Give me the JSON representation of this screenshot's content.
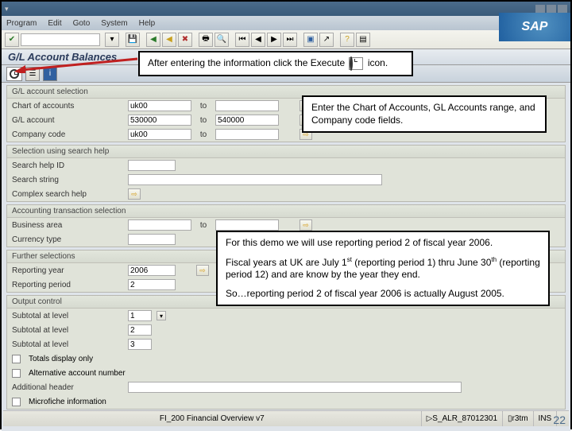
{
  "menu": {
    "items": [
      "Program",
      "Edit",
      "Goto",
      "System",
      "Help"
    ]
  },
  "logo": "SAP",
  "screen_title": "G/L Account Balances",
  "sections": {
    "acct": {
      "title": "G/L account selection",
      "rows": [
        {
          "label": "Chart of accounts",
          "from": "uk00",
          "to": ""
        },
        {
          "label": "G/L account",
          "from": "530000",
          "to": "540000"
        },
        {
          "label": "Company code",
          "from": "uk00",
          "to": ""
        }
      ]
    },
    "search": {
      "title": "Selection using search help",
      "rows": [
        {
          "label": "Search help ID"
        },
        {
          "label": "Search string"
        },
        {
          "label": "Complex search help"
        }
      ]
    },
    "trans": {
      "title": "Accounting transaction selection",
      "rows": [
        {
          "label": "Business area",
          "from": "",
          "to": ""
        },
        {
          "label": "Currency type"
        }
      ]
    },
    "further": {
      "title": "Further selections",
      "rows": [
        {
          "label": "Reporting year",
          "val": "2006"
        },
        {
          "label": "Reporting period",
          "val": "2"
        }
      ]
    },
    "output": {
      "title": "Output control",
      "rows": [
        {
          "label": "Subtotal at level",
          "val": "1"
        },
        {
          "label": "Subtotal at level",
          "val": "2"
        },
        {
          "label": "Subtotal at level",
          "val": "3"
        }
      ],
      "checks": [
        "Totals display only",
        "Alternative account number"
      ],
      "addl": "Additional header",
      "micro": "Microfiche information"
    }
  },
  "callouts": {
    "c1a": "After entering the information click the Execute",
    "c1b": "icon.",
    "c2": "Enter the Chart of Accounts, GL Accounts range, and Company code fields.",
    "c3a": "For this demo we will use reporting period 2 of fiscal year 2006.",
    "c3b_1": "Fiscal years at UK are July 1",
    "c3b_2": " (reporting period 1) thru June 30",
    "c3b_3": " (reporting period 12) and are know by the year they end.",
    "c3c": "So…reporting period 2 of fiscal year 2006 is actually August 2005."
  },
  "status": {
    "center": "FI_200 Financial Overview v7",
    "tcode": "S_ALR_87012301",
    "client": "r3tm",
    "server": "INS"
  },
  "slide": "22"
}
